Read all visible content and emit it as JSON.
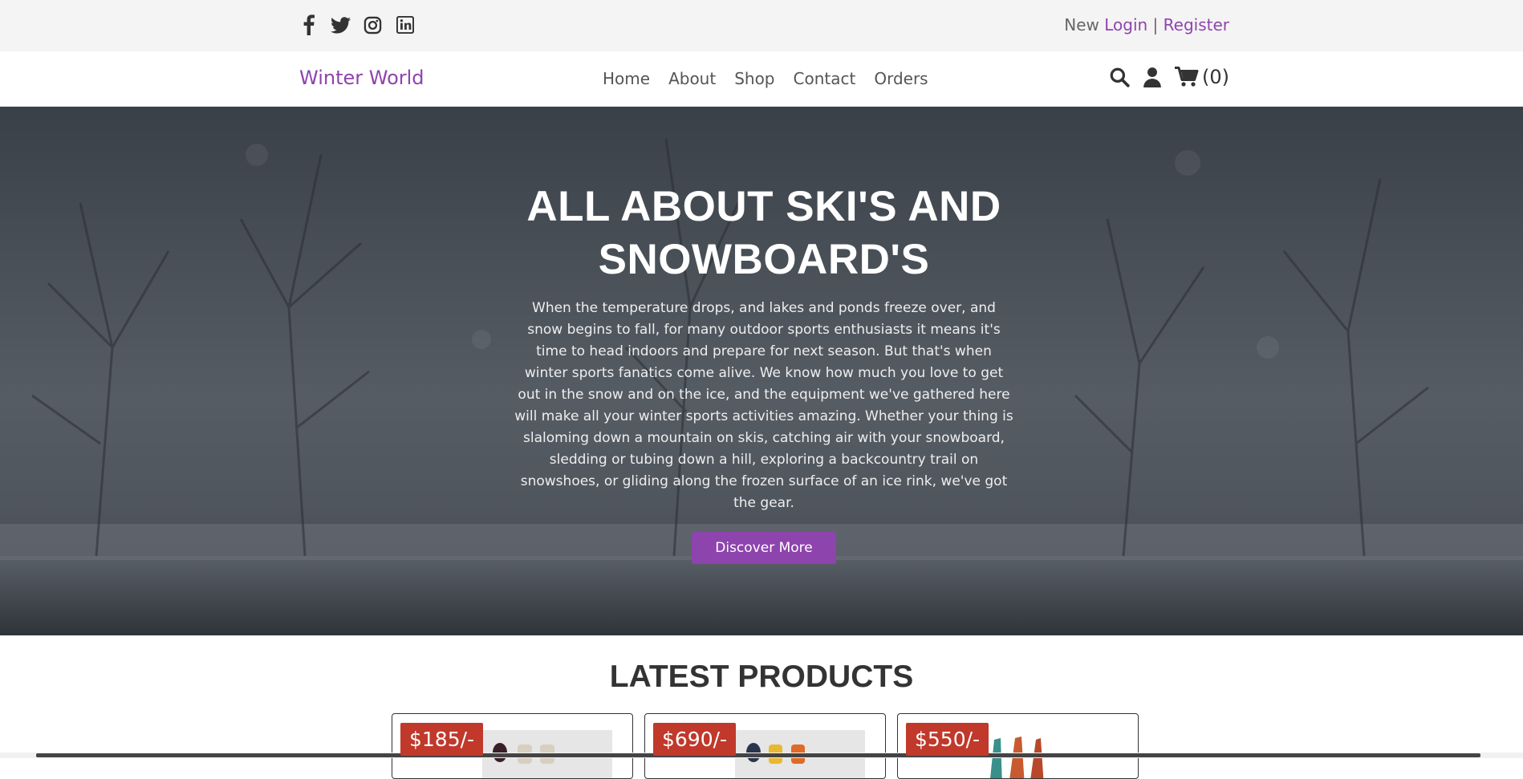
{
  "topbar": {
    "social": [
      "facebook-icon",
      "twitter-icon",
      "instagram-icon",
      "linkedin-icon"
    ],
    "auth": {
      "prefix": "New",
      "login": "Login",
      "separator": "|",
      "register": "Register"
    }
  },
  "navbar": {
    "logo": "Winter World",
    "menu": [
      "Home",
      "About",
      "Shop",
      "Contact",
      "Orders"
    ],
    "cart_count": "(0)"
  },
  "hero": {
    "title_line1": "ALL ABOUT SKI'S AND",
    "title_line2": "SNOWBOARD'S",
    "text": "When the temperature drops, and lakes and ponds freeze over, and snow begins to fall, for many outdoor sports enthusiasts it means it's time to head indoors and prepare for next season. But that's when winter sports fanatics come alive. We know how much you love to get out in the snow and on the ice, and the equipment we've gathered here will make all your winter sports activities amazing. Whether your thing is slaloming down a mountain on skis, catching air with your snowboard, sledding or tubing down a hill, exploring a backcountry trail on snowshoes, or gliding along the frozen surface of an ice rink, we've got the gear.",
    "button": "Discover More"
  },
  "products": {
    "title": "LATEST PRODUCTS",
    "items": [
      {
        "price": "$185/-"
      },
      {
        "price": "$690/-"
      },
      {
        "price": "$550/-"
      }
    ]
  },
  "colors": {
    "accent": "#8e44ad",
    "price_badge": "#c0392b",
    "topbar_bg": "#f4f4f4"
  }
}
